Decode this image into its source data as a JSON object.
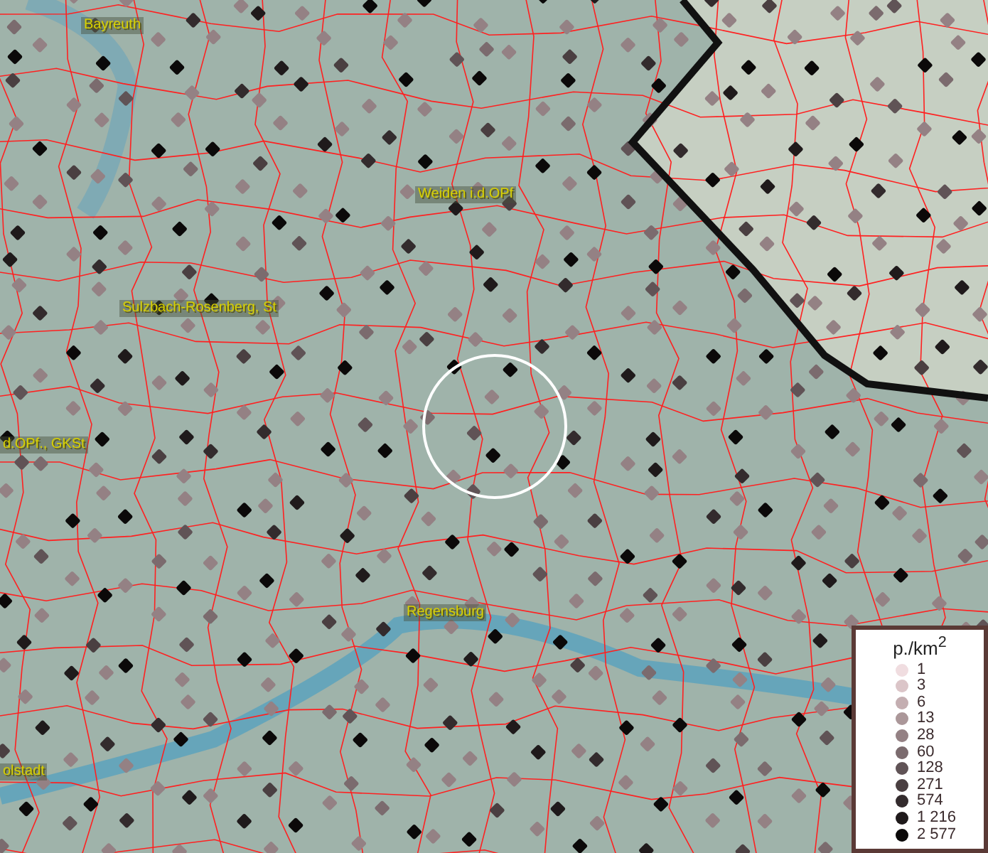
{
  "map": {
    "place_labels": [
      "Bayreuth",
      "Weiden i.d.OPf",
      "Sulzbach-Rosenberg, St",
      "d.OPf., GKSt",
      "Regensburg",
      "olstadt"
    ]
  },
  "legend": {
    "title": "p./km$^{2}$",
    "items": [
      {
        "label": "1",
        "color": "#f0dde0"
      },
      {
        "label": "3",
        "color": "#dbc5c8"
      },
      {
        "label": "6",
        "color": "#c4aeb1"
      },
      {
        "label": "13",
        "color": "#ab9799"
      },
      {
        "label": "28",
        "color": "#948184"
      },
      {
        "label": "60",
        "color": "#7b6b6e"
      },
      {
        "label": "128",
        "color": "#605356"
      },
      {
        "label": "271",
        "color": "#4a3f41"
      },
      {
        "label": "574",
        "color": "#332b2d"
      },
      {
        "label": "1 216",
        "color": "#1f1a1b"
      },
      {
        "label": "2 577",
        "color": "#0b0909"
      }
    ]
  }
}
